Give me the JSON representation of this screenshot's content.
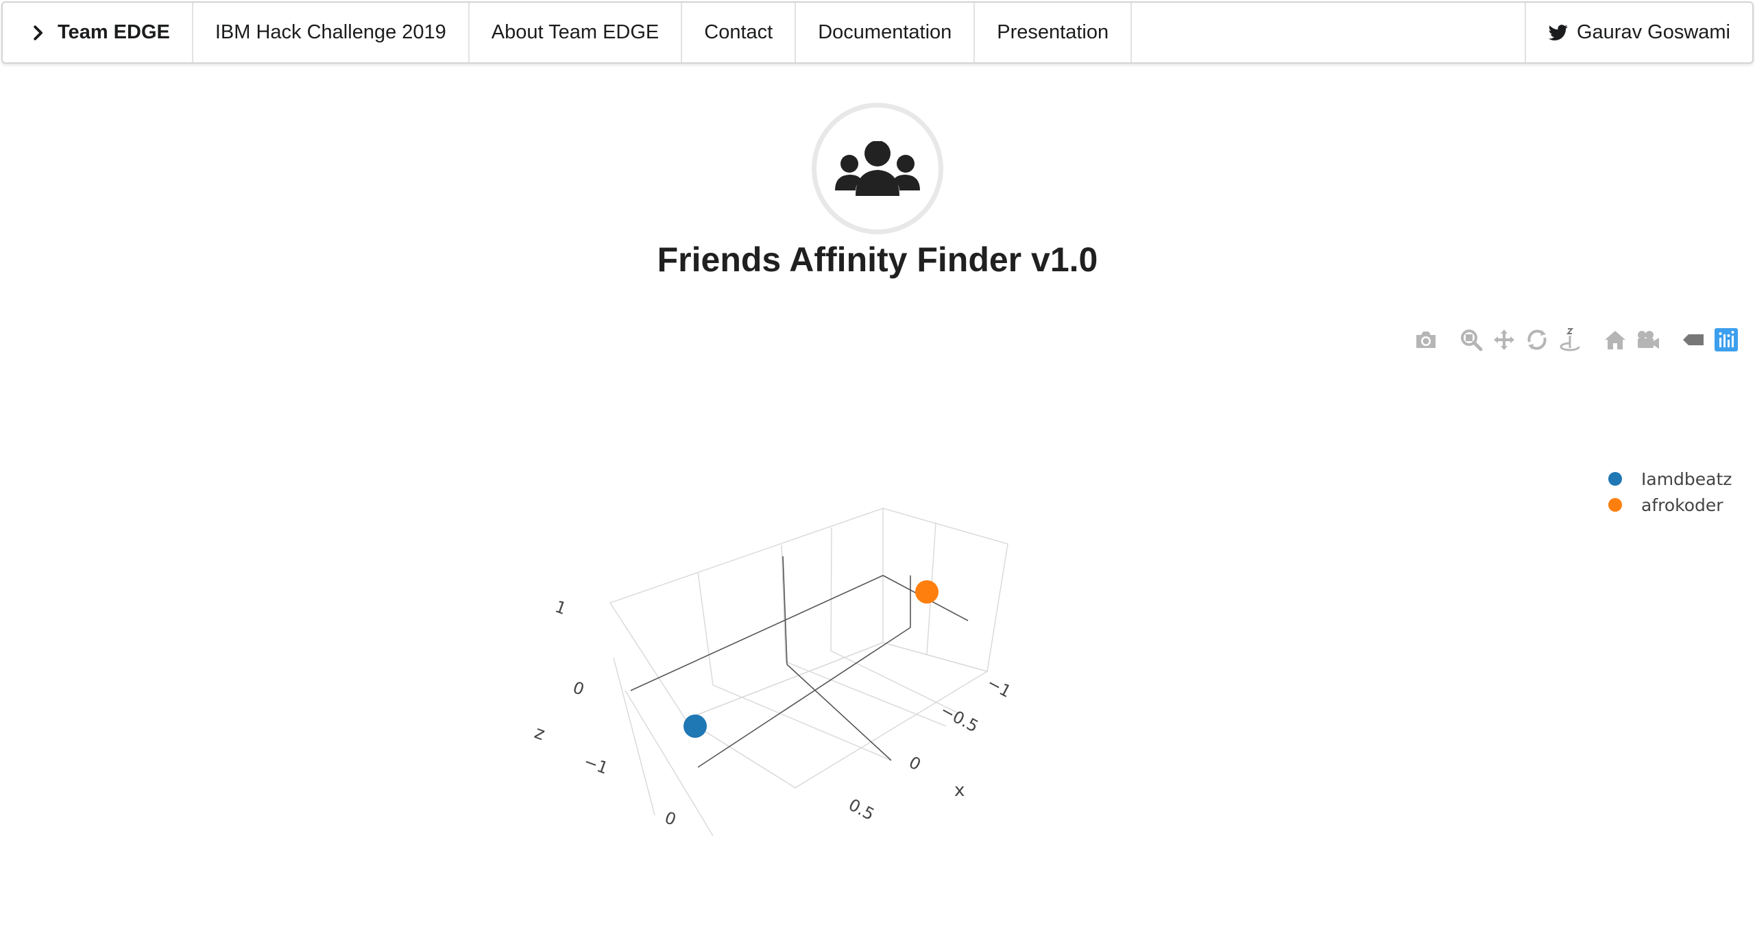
{
  "nav": {
    "brand": "Team EDGE",
    "items": [
      {
        "label": "IBM Hack Challenge 2019"
      },
      {
        "label": "About Team EDGE"
      },
      {
        "label": "Contact"
      },
      {
        "label": "Documentation"
      },
      {
        "label": "Presentation"
      }
    ],
    "user": "Gaurav Goswami",
    "user_icon": "twitter-icon",
    "brand_icon": "chevron-right-icon"
  },
  "header": {
    "title": "Friends Affinity Finder v1.0",
    "logo_icon": "users-icon"
  },
  "modebar": {
    "buttons": [
      "camera-icon",
      "zoom-icon",
      "pan-icon",
      "orbit-rotation-icon",
      "turntable-rotation-icon",
      "reset-camera-icon",
      "last-save-camera-icon",
      "hover-toggle-icon",
      "plotly-logo-icon"
    ],
    "accent": "#3c9fee"
  },
  "chart_data": {
    "type": "scatter3d",
    "axes": {
      "x": {
        "label": "x",
        "ticks": [
          "−1",
          "−0.5",
          "0",
          "0.5"
        ]
      },
      "y": {
        "label": "",
        "ticks": [
          "0"
        ]
      },
      "z": {
        "label": "z",
        "ticks": [
          "1",
          "0",
          "−1"
        ]
      }
    },
    "series": [
      {
        "name": "Iamdbeatz",
        "color": "#1f77b4"
      },
      {
        "name": "afrokoder",
        "color": "#ff7f0e"
      }
    ],
    "legend_position": "top-right"
  }
}
